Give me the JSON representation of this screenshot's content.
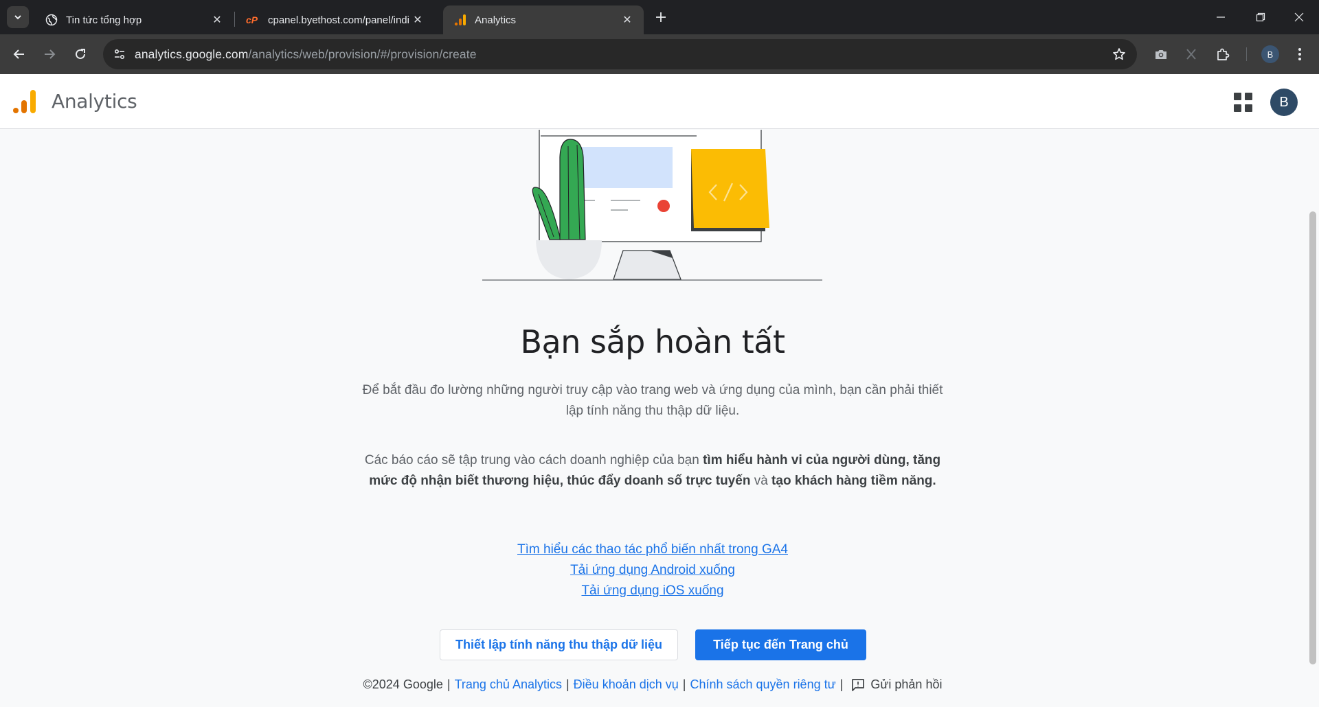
{
  "browser": {
    "tabs": [
      {
        "title": "Tin tức tổng hợp",
        "icon": "globe-icon",
        "active": false
      },
      {
        "title": "cpanel.byethost.com/panel/indi",
        "icon": "cpanel-icon",
        "active": false
      },
      {
        "title": "Analytics",
        "icon": "analytics-icon",
        "active": true
      }
    ],
    "url_host": "analytics.google.com",
    "url_path": "/analytics/web/provision/#/provision/create",
    "profile_initial": "B"
  },
  "app": {
    "name": "Analytics",
    "avatar_initial": "B",
    "brand_colors": {
      "orange": "#f9ab00",
      "orange_dark": "#e37400",
      "blue": "#1a73e8"
    }
  },
  "main": {
    "headline": "Bạn sắp hoàn tất",
    "para1": "Để bắt đầu đo lường những người truy cập vào trang web và ứng dụng của mình, bạn cần phải thiết lập tính năng thu thập dữ liệu.",
    "para2": {
      "prefix": "Các báo cáo sẽ tập trung vào cách doanh nghiệp của bạn ",
      "bold1": "tìm hiểu hành vi của người dùng, tăng mức độ nhận biết thương hiệu, thúc đẩy doanh số trực tuyến",
      "middle": " và ",
      "bold2": "tạo khách hàng tiềm năng."
    },
    "links": [
      "Tìm hiểu các thao tác phổ biến nhất trong GA4",
      "Tải ứng dụng Android xuống",
      "Tải ứng dụng iOS xuống"
    ],
    "setup_button": "Thiết lập tính năng thu thập dữ liệu",
    "continue_button": "Tiếp tục đến Trang chủ"
  },
  "footer": {
    "copyright": "©2024 Google",
    "links": [
      "Trang chủ Analytics",
      "Điều khoản dịch vụ",
      "Chính sách quyền riêng tư"
    ],
    "separator": "|",
    "feedback": "Gửi phản hồi"
  }
}
